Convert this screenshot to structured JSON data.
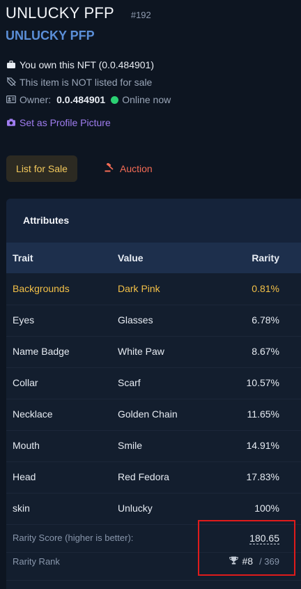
{
  "header": {
    "title": "UNLUCKY PFP",
    "nft_number": "#192",
    "collection": "UNLUCKY PFP"
  },
  "status": {
    "own_text": "You own this NFT (0.0.484901)",
    "not_listed_text": "This item is NOT listed for sale",
    "owner_label": "Owner:",
    "owner_account": "0.0.484901",
    "online_text": "Online now",
    "online_color": "#2bd173"
  },
  "actions": {
    "set_profile": "Set as Profile Picture",
    "list_for_sale": "List for Sale",
    "auction": "Auction"
  },
  "attributes": {
    "title": "Attributes",
    "headers": {
      "trait": "Trait",
      "value": "Value",
      "rarity": "Rarity"
    },
    "rows": [
      {
        "trait": "Backgrounds",
        "value": "Dark Pink",
        "rarity": "0.81%"
      },
      {
        "trait": "Eyes",
        "value": "Glasses",
        "rarity": "6.78%"
      },
      {
        "trait": "Name Badge",
        "value": "White Paw",
        "rarity": "8.67%"
      },
      {
        "trait": "Collar",
        "value": "Scarf",
        "rarity": "10.57%"
      },
      {
        "trait": "Necklace",
        "value": "Golden Chain",
        "rarity": "11.65%"
      },
      {
        "trait": "Mouth",
        "value": "Smile",
        "rarity": "14.91%"
      },
      {
        "trait": "Head",
        "value": "Red Fedora",
        "rarity": "17.83%"
      },
      {
        "trait": "skin",
        "value": "Unlucky",
        "rarity": "100%"
      }
    ],
    "rarity_score_label": "Rarity Score (higher is better):",
    "rarity_score": "180.65",
    "rarity_rank_label": "Rarity Rank",
    "rarity_rank": "#8",
    "rarity_rank_total": "/ 369"
  },
  "colors": {
    "accent_blue": "#5b8fd8",
    "highlight_gold": "#f3c047",
    "auction_red": "#f26b55",
    "profile_purple": "#a07df0",
    "annotation_red": "#e01b1b"
  }
}
